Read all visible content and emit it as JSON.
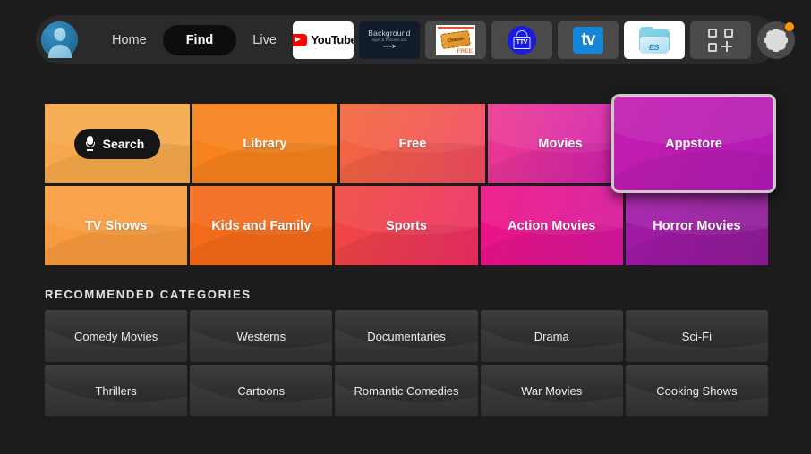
{
  "nav": {
    "avatar_name": "profile-avatar",
    "links": [
      {
        "label": "Home",
        "active": false
      },
      {
        "label": "Find",
        "active": true
      },
      {
        "label": "Live",
        "active": false
      }
    ],
    "apps": [
      {
        "name": "youtube",
        "label": "YouTube"
      },
      {
        "name": "background-apps",
        "line1": "Background",
        "line2": "Apps & Process List",
        "line3": "⌁⌁⌁➤"
      },
      {
        "name": "cinema-ticket",
        "ticket_text": "CINEMA",
        "free_text": "FREE"
      },
      {
        "name": "ttv-app",
        "label": "TTV"
      },
      {
        "name": "tv-app",
        "label": "tv"
      },
      {
        "name": "es-file-explorer",
        "label": "ES"
      },
      {
        "name": "add-apps",
        "label": ""
      }
    ],
    "settings_label": "Settings"
  },
  "tiles": {
    "row1": [
      {
        "label": "Search",
        "is_search": true,
        "color": "#f6a84a"
      },
      {
        "label": "Library",
        "color": "#f7821b"
      },
      {
        "label": "Free",
        "color": "#f2554a"
      },
      {
        "label": "Movies",
        "color": "#ec2d8e"
      },
      {
        "label": "Appstore",
        "color": "#bb17a8",
        "focused": true
      }
    ],
    "row2": [
      {
        "label": "TV Shows",
        "color": "#f89b3e"
      },
      {
        "label": "Kids and Family",
        "color": "#f5691a"
      },
      {
        "label": "Sports",
        "color": "#ef4052"
      },
      {
        "label": "Action Movies",
        "color": "#e5158c"
      },
      {
        "label": "Horror Movies",
        "color": "#9c1a9c"
      }
    ]
  },
  "recommended": {
    "title": "RECOMMENDED CATEGORIES",
    "row1": [
      "Comedy Movies",
      "Westerns",
      "Documentaries",
      "Drama",
      "Sci-Fi"
    ],
    "row2": [
      "Thrillers",
      "Cartoons",
      "Romantic Comedies",
      "War Movies",
      "Cooking Shows"
    ]
  },
  "colors": {
    "background": "#1c1c1c",
    "navbar": "#2a2a2a",
    "active_pill": "#0d0d0d",
    "focus_border": "#cfc9c9",
    "notification_dot": "#ff9500",
    "category_tile": "#3a3a3a"
  }
}
